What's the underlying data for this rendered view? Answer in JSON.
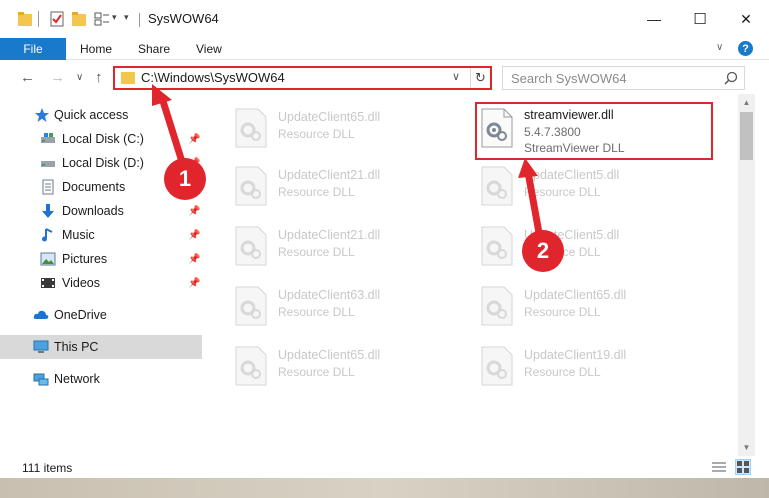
{
  "window": {
    "title": "SysWOW64",
    "minimize_glyph": "—",
    "maximize_glyph": "☐",
    "close_glyph": "✕"
  },
  "ribbon": {
    "tabs": [
      "File",
      "Home",
      "Share",
      "View"
    ],
    "collapse_glyph": "∨",
    "help_glyph": "?"
  },
  "address": {
    "path": "C:\\Windows\\SysWOW64",
    "dropdown_glyph": "∨",
    "refresh_glyph": "↻",
    "back_glyph": "←",
    "forward_glyph": "→",
    "recent_glyph": "∨",
    "up_glyph": "↑"
  },
  "search": {
    "placeholder": "Search SysWOW64"
  },
  "sidebar": {
    "items": [
      {
        "label": "Quick access",
        "icon": "star-icon"
      },
      {
        "label": "Local Disk (C:)",
        "icon": "drive-icon",
        "pinned": true
      },
      {
        "label": "Local Disk (D:)",
        "icon": "drive-icon",
        "pinned": true
      },
      {
        "label": "Documents",
        "icon": "documents-icon",
        "pinned": true
      },
      {
        "label": "Downloads",
        "icon": "download-icon",
        "pinned": true
      },
      {
        "label": "Music",
        "icon": "music-icon",
        "pinned": true
      },
      {
        "label": "Pictures",
        "icon": "pictures-icon",
        "pinned": true
      },
      {
        "label": "Videos",
        "icon": "videos-icon",
        "pinned": true
      },
      {
        "label": "OneDrive",
        "icon": "cloud-icon"
      },
      {
        "label": "This PC",
        "icon": "computer-icon",
        "selected": true
      },
      {
        "label": "Network",
        "icon": "network-icon"
      }
    ],
    "pin_glyph": "📌"
  },
  "files": [
    {
      "name": "UpdateClient65.dll",
      "type": "Resource DLL"
    },
    {
      "name": "streamviewer.dll",
      "version": "5.4.7.3800",
      "type": "StreamViewer DLL",
      "highlighted": true
    },
    {
      "name": "UpdateClient21.dll",
      "type": "Resource DLL"
    },
    {
      "name": "UpdateClient5.dll",
      "type": "Resource DLL"
    },
    {
      "name": "UpdateClient21.dll",
      "type": "Resource DLL"
    },
    {
      "name": "UpdateClient5.dll",
      "type": "Resource DLL"
    },
    {
      "name": "UpdateClient63.dll",
      "type": "Resource DLL"
    },
    {
      "name": "UpdateClient65.dll",
      "type": "Resource DLL"
    },
    {
      "name": "UpdateClient65.dll",
      "type": "Resource DLL"
    },
    {
      "name": "UpdateClient19.dll",
      "type": "Resource DLL"
    }
  ],
  "status": {
    "item_count": "111 items"
  },
  "annotations": {
    "marker1": "1",
    "marker2": "2",
    "color": "#e0262c"
  },
  "colors": {
    "accent": "#1979ca",
    "highlight": "#e0262c",
    "selected_nav": "#d9d9d9",
    "folder": "#f3c74d"
  }
}
